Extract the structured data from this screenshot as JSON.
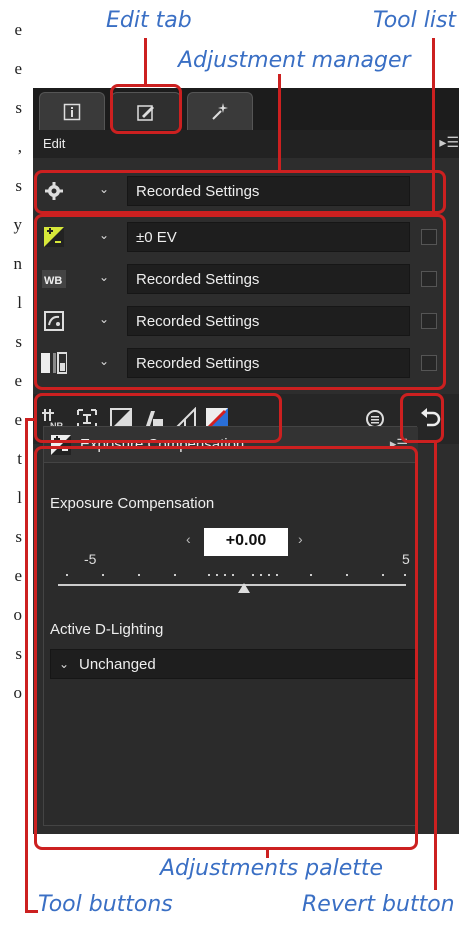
{
  "callouts": {
    "edit_tab": "Edit tab",
    "tool_list": "Tool list",
    "adjustment_manager": "Adjustment manager",
    "adjustments_palette": "Adjustments palette",
    "tool_buttons": "Tool buttons",
    "revert_button": "Revert button"
  },
  "left_text": [
    "e",
    "e",
    "s",
    ",",
    "s",
    "y",
    "n",
    "l",
    "s",
    "e",
    "e",
    "t",
    "l",
    "s",
    "e",
    "o",
    "s",
    "o"
  ],
  "tabs": [
    {
      "name": "info",
      "icon": "info-icon"
    },
    {
      "name": "edit",
      "icon": "edit-pencil-icon"
    },
    {
      "name": "effects",
      "icon": "magic-wand-icon"
    }
  ],
  "edit_header": {
    "label": "Edit",
    "menu_icon": "panel-menu-icon",
    "close_icon": "close-icon"
  },
  "adjustment_manager": {
    "value": "Recorded Settings",
    "icon": "gear-icon"
  },
  "tool_list": [
    {
      "icon": "exposure-icon",
      "value": "±0 EV"
    },
    {
      "icon": "white-balance-icon",
      "value": "Recorded Settings"
    },
    {
      "icon": "picture-control-icon",
      "value": "Recorded Settings"
    },
    {
      "icon": "tone-levels-icon",
      "value": "Recorded Settings"
    }
  ],
  "tool_buttons": [
    "noise-reduction-icon",
    "crop-icon",
    "levels-curves-icon",
    "lch-icon",
    "color-balance-icon",
    "rgb-curve-icon"
  ],
  "toolbar_right": {
    "history_icon": "history-icon",
    "revert_icon": "revert-icon"
  },
  "palette": {
    "title": "Exposure Compensation",
    "section_label": "Exposure Compensation",
    "value": "+0.00",
    "scale_min": "-5",
    "scale_max": "5",
    "adl_label": "Active D-Lighting",
    "adl_value": "Unchanged"
  },
  "colors": {
    "callout": "#3a6fc4",
    "highlight": "#cc2020",
    "panel": "#2d2d2d"
  }
}
